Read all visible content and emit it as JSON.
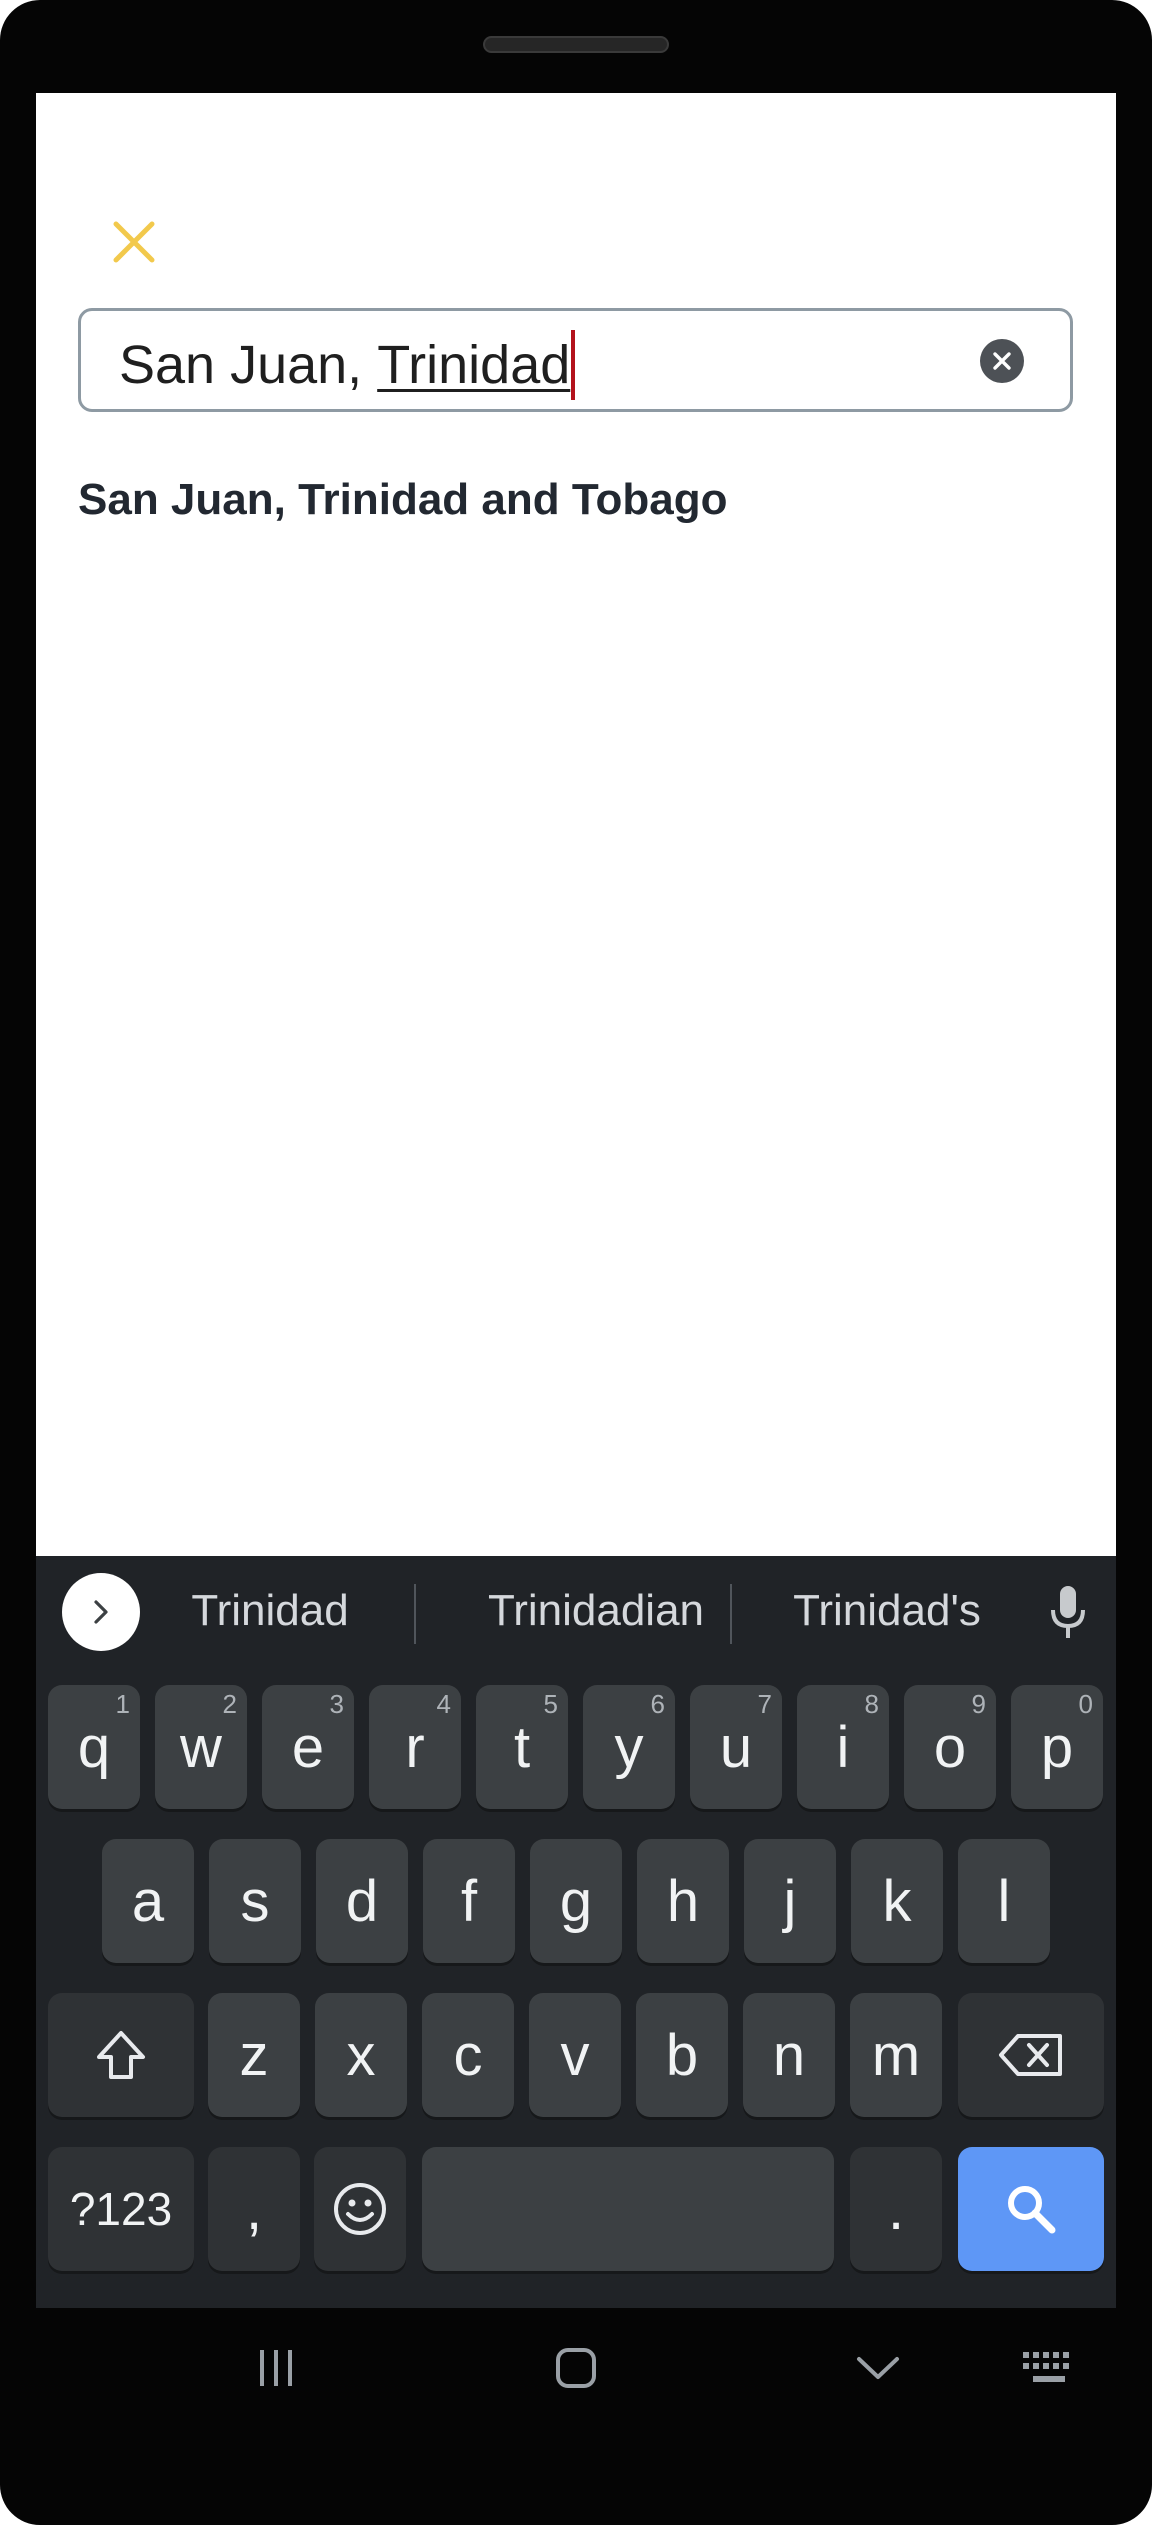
{
  "search": {
    "value_committed": "San Juan, ",
    "value_composing": "Trinidad"
  },
  "results": [
    {
      "label": "San Juan, Trinidad and Tobago"
    }
  ],
  "keyboard": {
    "predictions": [
      "Trinidad",
      "Trinidadian",
      "Trinidad's"
    ],
    "row1": [
      {
        "key": "q",
        "hint": "1"
      },
      {
        "key": "w",
        "hint": "2"
      },
      {
        "key": "e",
        "hint": "3"
      },
      {
        "key": "r",
        "hint": "4"
      },
      {
        "key": "t",
        "hint": "5"
      },
      {
        "key": "y",
        "hint": "6"
      },
      {
        "key": "u",
        "hint": "7"
      },
      {
        "key": "i",
        "hint": "8"
      },
      {
        "key": "o",
        "hint": "9"
      },
      {
        "key": "p",
        "hint": "0"
      }
    ],
    "row2": [
      "a",
      "s",
      "d",
      "f",
      "g",
      "h",
      "j",
      "k",
      "l"
    ],
    "row3": [
      "z",
      "x",
      "c",
      "v",
      "b",
      "n",
      "m"
    ],
    "symbols_label": "?123",
    "comma_label": ",",
    "period_label": "."
  },
  "colors": {
    "close_icon": "#f2c94c",
    "keyboard_bg": "#202327",
    "key_bg": "#3c4043",
    "search_key": "#5e97f6",
    "caret": "#b3121c"
  },
  "icons": {
    "close": "close-icon",
    "clear": "clear-icon",
    "expand": "chevron-right-icon",
    "mic": "microphone-icon",
    "shift": "shift-icon",
    "backspace": "backspace-icon",
    "emoji": "emoji-icon",
    "search": "search-icon",
    "nav_recents": "recents-icon",
    "nav_home": "home-icon",
    "nav_back": "chevron-down-icon",
    "nav_keyboard": "keyboard-icon"
  }
}
